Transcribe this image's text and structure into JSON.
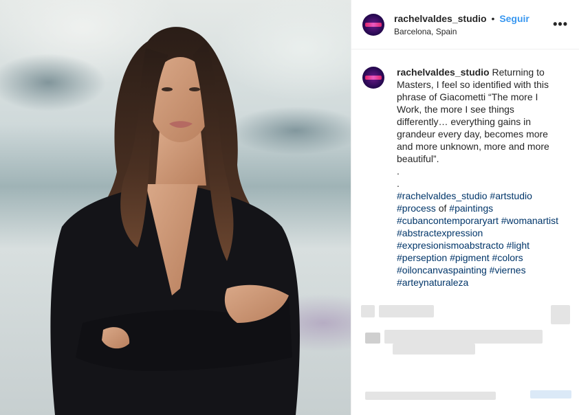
{
  "post": {
    "username": "rachelvaldes_studio",
    "follow_label": "Seguir",
    "separator": "•",
    "location": "Barcelona, Spain",
    "more_label": "•••"
  },
  "caption": {
    "username": "rachelvaldes_studio",
    "text": " Returning to Masters, I feel so identified with this phrase of Giacometti “The more I Work, the more I see things differently… everything gains in grandeur every day, becomes more and more unknown, more and more beautiful”.",
    "dot1": ".",
    "dot2": ".",
    "tags": [
      {
        "text": "#rachelvaldes_studio"
      },
      {
        "text": " "
      },
      {
        "text": "#artstudio"
      },
      {
        "text": " "
      },
      {
        "text": "#process"
      },
      {
        "text": " of "
      },
      {
        "text": "#paintings"
      },
      {
        "text": " "
      },
      {
        "text": "#cubancontemporaryart"
      },
      {
        "text": " "
      },
      {
        "text": "#womanartist"
      },
      {
        "text": " "
      },
      {
        "text": "#abstractexpression"
      },
      {
        "text": " "
      },
      {
        "text": "#expresionismoabstracto"
      },
      {
        "text": " "
      },
      {
        "text": "#light"
      },
      {
        "text": " "
      },
      {
        "text": "#perseption"
      },
      {
        "text": " "
      },
      {
        "text": "#pigment"
      },
      {
        "text": " "
      },
      {
        "text": "#colors"
      },
      {
        "text": " "
      },
      {
        "text": "#oiloncanvaspainting"
      },
      {
        "text": " "
      },
      {
        "text": "#viernes"
      },
      {
        "text": " "
      },
      {
        "text": "#arteynaturaleza"
      }
    ]
  },
  "icons": {
    "avatar": "profile-avatar",
    "more": "more-options-icon"
  },
  "colors": {
    "link": "#3897f0",
    "hashtag": "#003569",
    "text": "#262626"
  }
}
